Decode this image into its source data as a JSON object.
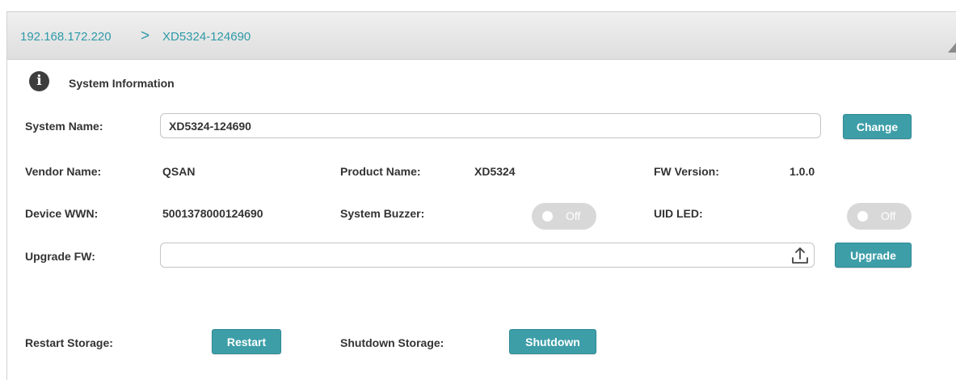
{
  "breadcrumb": {
    "items": [
      "192.168.172.220",
      "XD5324-124690"
    ],
    "separator": ">"
  },
  "section": {
    "title": "System Information",
    "icon": "info-icon"
  },
  "system_name": {
    "label": "System Name:",
    "value": "XD5324-124690",
    "button": "Change"
  },
  "vendor": {
    "label": "Vendor Name:",
    "value": "QSAN"
  },
  "product": {
    "label": "Product Name:",
    "value": "XD5324"
  },
  "fw_version": {
    "label": "FW Version:",
    "value": "1.0.0"
  },
  "device_wwn": {
    "label": "Device WWN:",
    "value": "5001378000124690"
  },
  "buzzer": {
    "label": "System Buzzer:",
    "state": "Off"
  },
  "uid_led": {
    "label": "UID LED:",
    "state": "Off"
  },
  "upgrade_fw": {
    "label": "Upgrade FW:",
    "value": "",
    "button": "Upgrade",
    "icon": "upload-icon"
  },
  "restart": {
    "label": "Restart Storage:",
    "button": "Restart"
  },
  "shutdown": {
    "label": "Shutdown Storage:",
    "button": "Shutdown"
  },
  "colors": {
    "accent": "#3d9ea8",
    "link": "#2f9aa8",
    "toggle_off": "#d8d8d8",
    "header_bg": "#e6e6e6"
  }
}
